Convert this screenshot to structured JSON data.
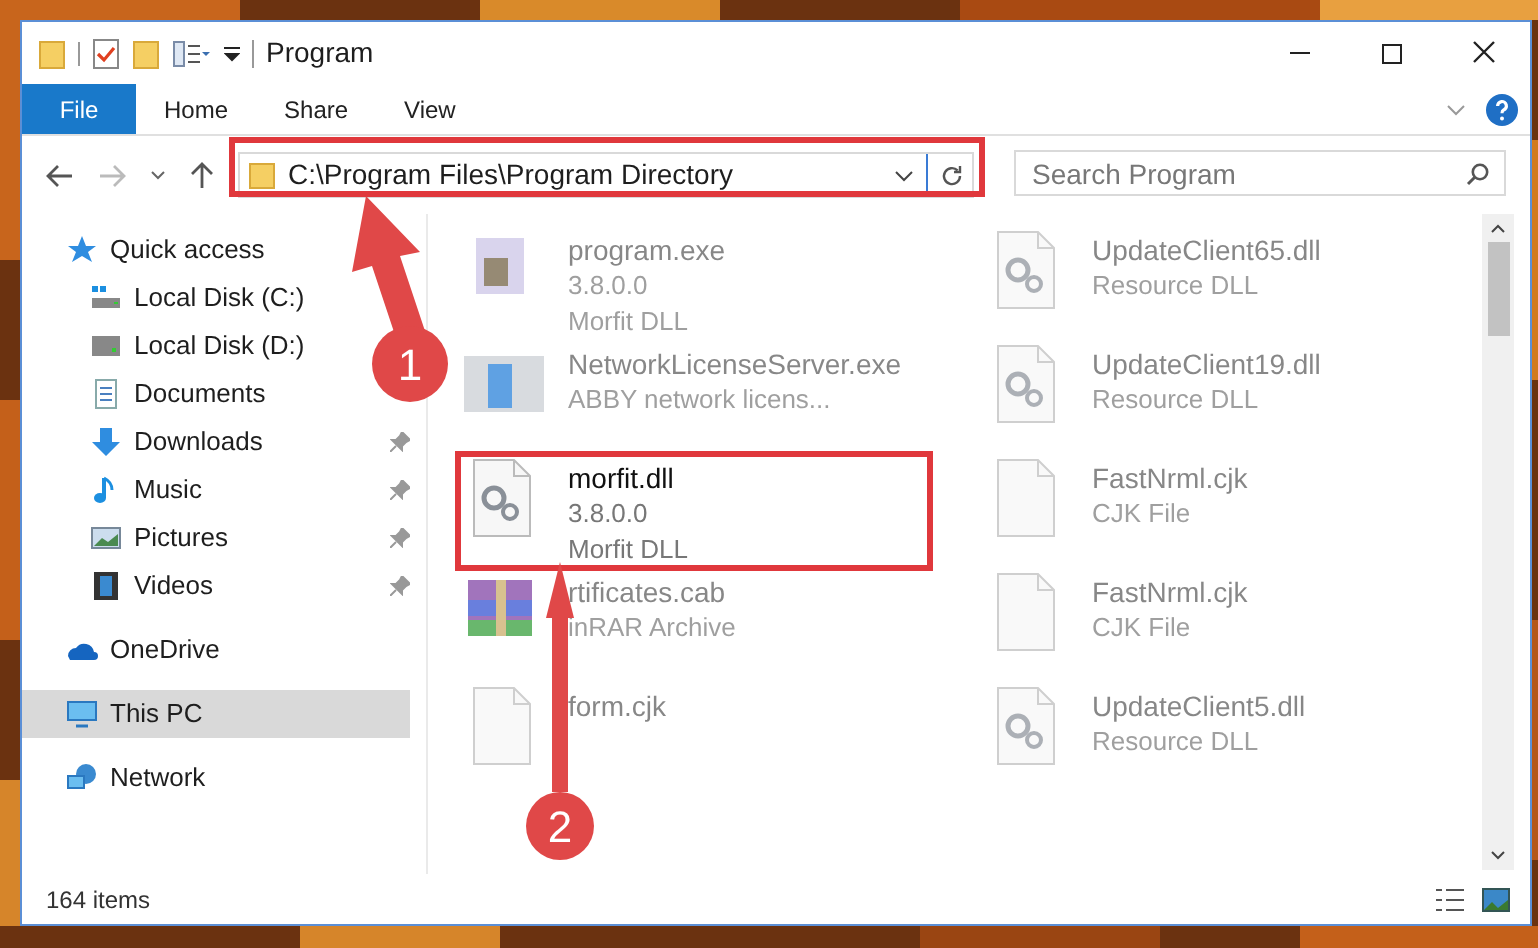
{
  "window": {
    "title": "Program"
  },
  "ribbon": {
    "tabs": [
      {
        "label": "File",
        "kind": "file"
      },
      {
        "label": "Home",
        "kind": "tab"
      },
      {
        "label": "Share",
        "kind": "tab"
      },
      {
        "label": "View",
        "kind": "tab"
      }
    ]
  },
  "address": {
    "path": "C:\\Program Files\\Program Directory"
  },
  "search": {
    "placeholder": "Search Program"
  },
  "sidebar": {
    "items": [
      {
        "label": "Quick access",
        "selected": false,
        "children": [
          {
            "label": "Local Disk (C:)",
            "pinned": false,
            "selected": false
          },
          {
            "label": "Local Disk (D:)",
            "pinned": false,
            "selected": false
          },
          {
            "label": "Documents",
            "pinned": false,
            "selected": false
          },
          {
            "label": "Downloads",
            "pinned": true,
            "selected": false
          },
          {
            "label": "Music",
            "pinned": true,
            "selected": false
          },
          {
            "label": "Pictures",
            "pinned": true,
            "selected": false
          },
          {
            "label": "Videos",
            "pinned": true,
            "selected": false
          }
        ]
      },
      {
        "label": "OneDrive",
        "selected": false
      },
      {
        "label": "This PC",
        "selected": true
      },
      {
        "label": "Network",
        "selected": false
      }
    ]
  },
  "files": [
    {
      "name": "program.exe",
      "details": [
        "3.8.0.0",
        "Morfit DLL"
      ],
      "blurred": true
    },
    {
      "name": "UpdateClient65.dll",
      "details": [
        "Resource DLL"
      ],
      "blurred": true
    },
    {
      "name": "NetworkLicenseServer.exe",
      "details": [
        "ABBY network licens..."
      ],
      "blurred": true
    },
    {
      "name": "UpdateClient19.dll",
      "details": [
        "Resource DLL"
      ],
      "blurred": true
    },
    {
      "name": "morfit.dll",
      "details": [
        "3.8.0.0",
        "Morfit DLL"
      ],
      "blurred": false
    },
    {
      "name": "FastNrml.cjk",
      "details": [
        "CJK File"
      ],
      "blurred": true
    },
    {
      "name": "rtificates.cab",
      "details": [
        "inRAR Archive"
      ],
      "blurred": true
    },
    {
      "name": "FastNrml.cjk",
      "details": [
        "CJK File"
      ],
      "blurred": true
    },
    {
      "name": "form.cjk",
      "blurred": true
    },
    {
      "name": "UpdateClient5.dll",
      "details": [
        "Resource DLL"
      ],
      "blurred": true
    }
  ],
  "status_bar": {
    "count": "164 items"
  },
  "annotations": [
    {
      "label": "1"
    },
    {
      "label": "2"
    }
  ]
}
